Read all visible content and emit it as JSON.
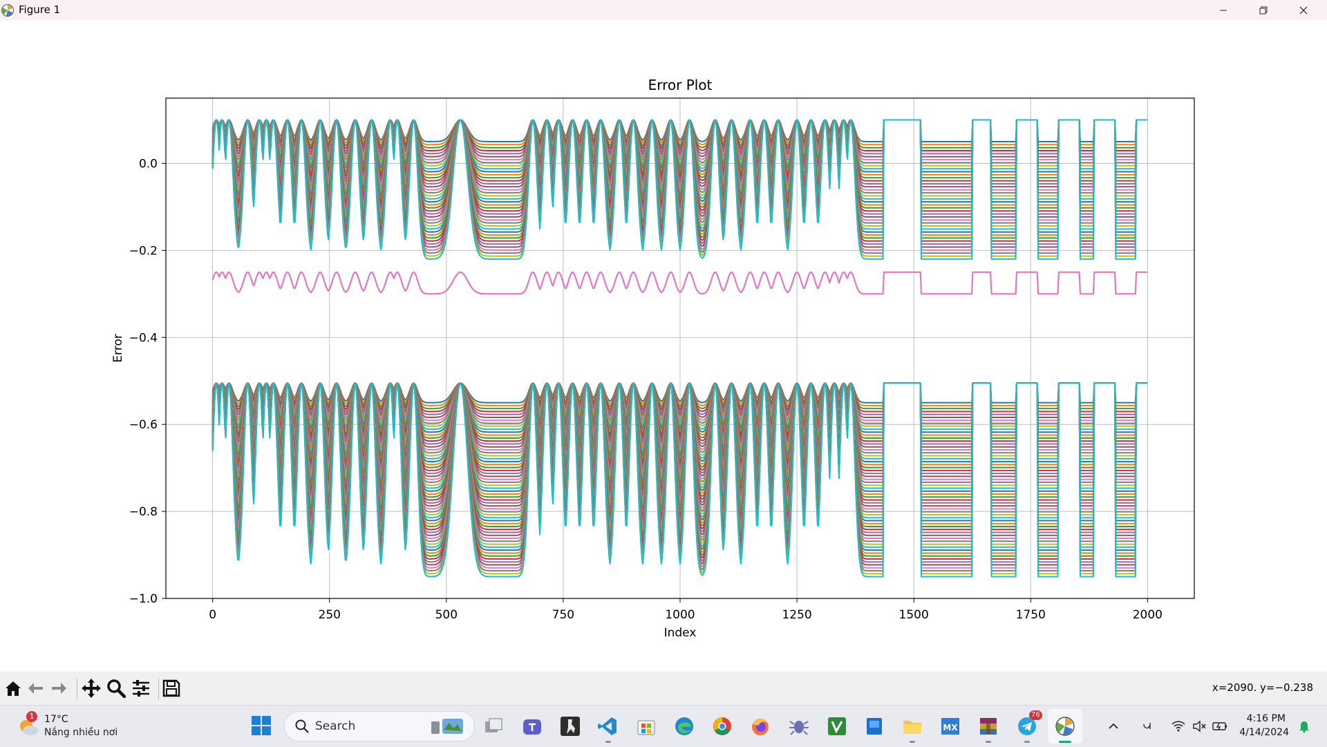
{
  "window": {
    "title": "Figure 1",
    "min_icon": "minimize-icon",
    "max_icon": "restore-icon",
    "close_icon": "close-icon"
  },
  "colors": {
    "tab10": [
      "#1f77b4",
      "#ff7f0e",
      "#2ca02c",
      "#d62728",
      "#9467bd",
      "#8c564b",
      "#e377c2",
      "#7f7f7f",
      "#bcbd22",
      "#17becf"
    ]
  },
  "chart_data": {
    "type": "line",
    "title": "Error Plot",
    "xlabel": "Index",
    "ylabel": "Error",
    "xlim": [
      -100,
      2100
    ],
    "ylim": [
      -1.0,
      0.15
    ],
    "x_ticks": [
      0,
      250,
      500,
      750,
      1000,
      1250,
      1500,
      1750,
      2000
    ],
    "x_tick_labels": [
      "0",
      "250",
      "500",
      "750",
      "1000",
      "1250",
      "1500",
      "1750",
      "2000"
    ],
    "y_ticks": [
      0.0,
      -0.2,
      -0.4,
      -0.6,
      -0.8,
      -1.0
    ],
    "y_tick_labels": [
      "0.0",
      "−0.2",
      "−0.4",
      "−0.6",
      "−0.8",
      "−1.0"
    ],
    "grid": true,
    "x_range": [
      0,
      2000
    ],
    "series_groups": [
      {
        "color_cycle": "tab10",
        "baseline_top": 0.05,
        "baseline_bottom": -0.22,
        "peak": 0.1,
        "series_count": 40
      },
      {
        "color": "#e377c2",
        "baseline": -0.3,
        "peak": -0.25,
        "series_count": 1
      },
      {
        "color_cycle": "tab10",
        "baseline_top": -0.55,
        "baseline_bottom": -0.95,
        "peak": -0.505,
        "series_count": 60
      }
    ],
    "peak_centers": [
      8,
      20,
      35,
      75,
      100,
      115,
      130,
      160,
      190,
      230,
      265,
      305,
      340,
      380,
      395,
      430,
      530,
      685,
      715,
      740,
      770,
      800,
      830,
      870,
      900,
      940,
      980,
      1020,
      1075,
      1110,
      1150,
      1180,
      1210,
      1250,
      1280,
      1310,
      1330,
      1350,
      1365
    ],
    "square_pulses": [
      [
        1435,
        1515
      ],
      [
        1625,
        1665
      ],
      [
        1720,
        1765
      ],
      [
        1810,
        1855
      ],
      [
        1885,
        1930
      ],
      [
        1975,
        2000
      ]
    ],
    "rounded_peak_width": 18
  },
  "toolbar": {
    "items": [
      {
        "name": "home-button",
        "icon": "home-icon"
      },
      {
        "name": "back-button",
        "icon": "arrow-left-icon"
      },
      {
        "name": "forward-button",
        "icon": "arrow-right-icon"
      },
      {
        "name": "pan-button",
        "icon": "move-icon"
      },
      {
        "name": "zoom-button",
        "icon": "magnifier-icon"
      },
      {
        "name": "configure-subplots-button",
        "icon": "sliders-icon"
      },
      {
        "name": "save-button",
        "icon": "floppy-icon"
      }
    ],
    "coords": "x=2090. y=−0.238"
  },
  "taskbar": {
    "weather": {
      "temp": "17°C",
      "condition": "Nắng nhiều nơi",
      "badge": "1"
    },
    "search_label": "Search",
    "telegram_badge": "76",
    "time": "4:16 PM",
    "date": "4/14/2024"
  }
}
